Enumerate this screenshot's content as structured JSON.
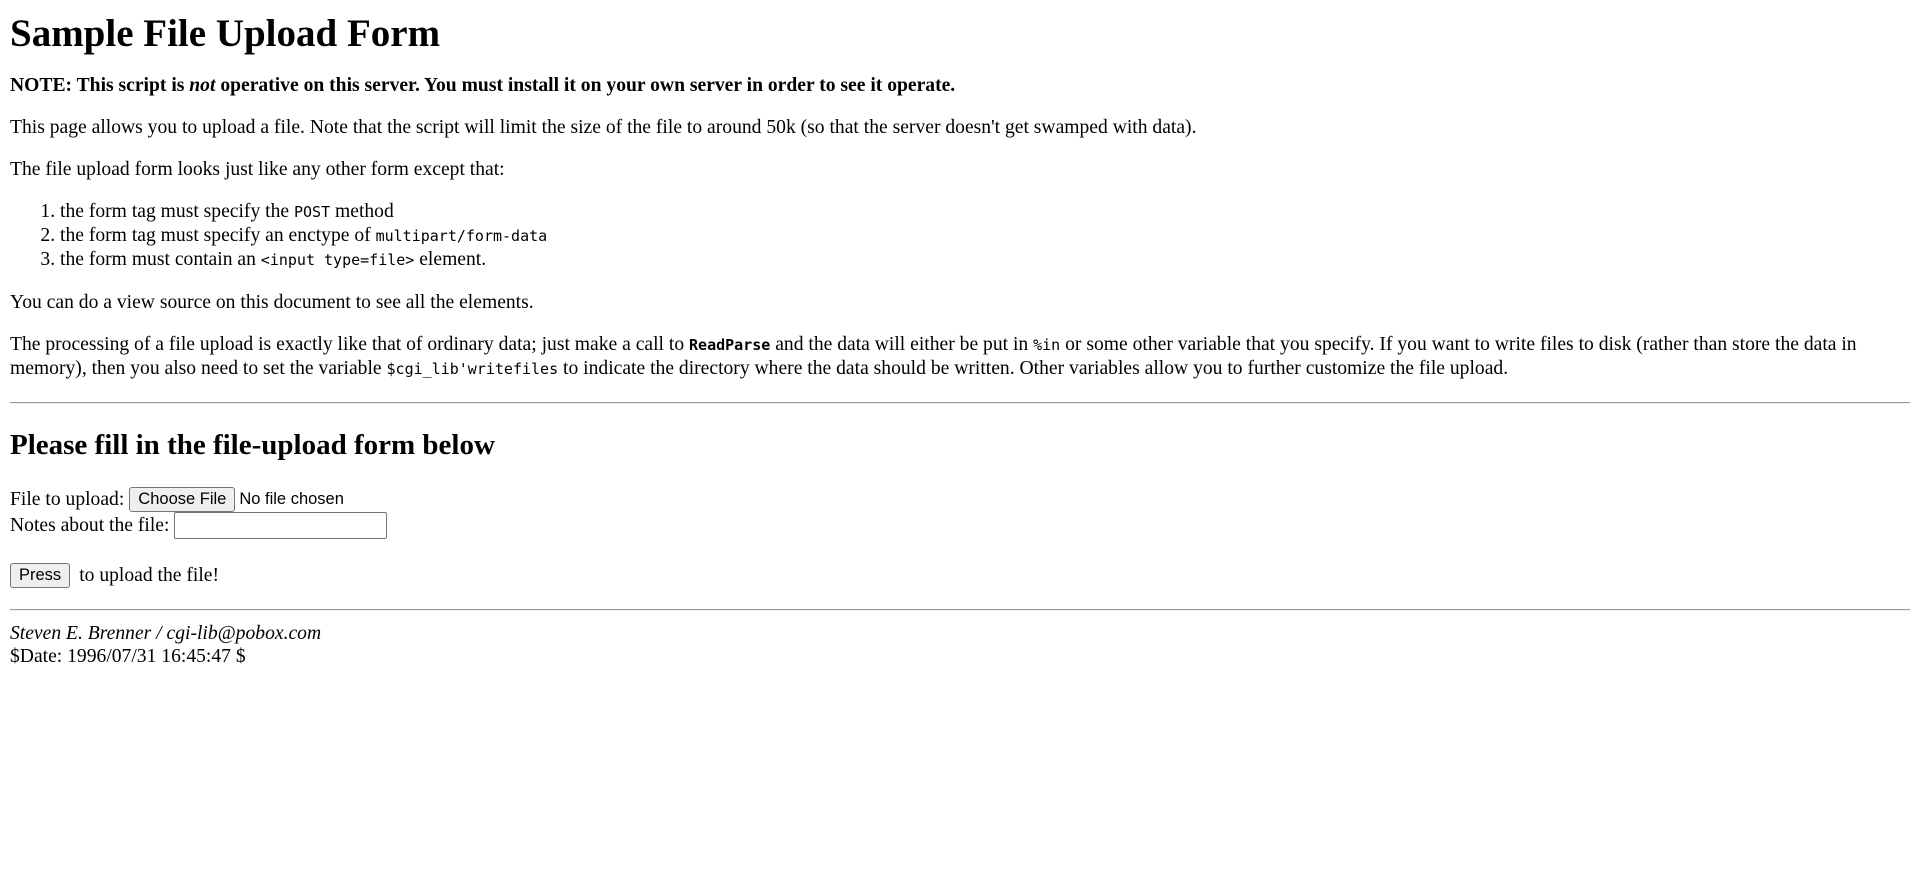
{
  "page": {
    "title": "Sample File Upload Form"
  },
  "note": {
    "prefix": "NOTE: This script is ",
    "emphasis": "not",
    "suffix": " operative on this server. You must install it on your own server in order to see it operate."
  },
  "intro": "This page allows you to upload a file. Note that the script will limit the size of the file to around 50k (so that the server doesn't get swamped with data).",
  "form_desc": "The file upload form looks just like any other form except that:",
  "rules": [
    {
      "before": "the form tag must specify the ",
      "code": "POST",
      "after": " method"
    },
    {
      "before": "the form tag must specify an enctype of ",
      "code": "multipart/form-data",
      "after": ""
    },
    {
      "before": "the form must contain an ",
      "code": "<input type=file>",
      "after": " element."
    }
  ],
  "view_source": "You can do a view source on this document to see all the elements.",
  "processing": {
    "part1": "The processing of a file upload is exactly like that of ordinary data; just make a call to ",
    "code1": "ReadParse",
    "part2": " and the data will either be put in ",
    "code2": "%in",
    "part3": " or some other variable that you specify. If you want to write files to disk (rather than store the data in memory), then you also need to set the variable ",
    "code3": "$cgi_lib'writefiles",
    "part4": " to indicate the directory where the data should be written. Other variables allow you to further customize the file upload."
  },
  "form": {
    "heading": "Please fill in the file-upload form below",
    "file_label": "File to upload:",
    "file_button": "Choose File",
    "file_status": "No file chosen",
    "notes_label": "Notes about the file:",
    "notes_value": "",
    "press_button": "Press",
    "press_suffix": "to upload the file!"
  },
  "footer": {
    "author": "Steven E. Brenner / cgi-lib@pobox.com",
    "date": "$Date: 1996/07/31 16:45:47 $"
  }
}
